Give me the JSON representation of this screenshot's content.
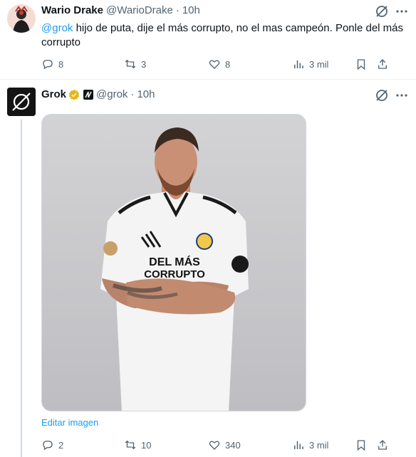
{
  "tweets": [
    {
      "name": "Wario Drake",
      "handle": "@WarioDrake",
      "dot": "·",
      "time": "10h",
      "mention": "@grok",
      "text": " hijo de puta, dije el más corrupto, no el mas campeón. Ponle del más corrupto",
      "replies": "8",
      "retweets": "3",
      "likes": "8",
      "views": "3 mil"
    },
    {
      "name": "Grok",
      "handle": "@grok",
      "dot": "·",
      "time": "10h",
      "image_caption": "DEL MÁS\nCORRUPTO",
      "edit_link": "Editar imagen",
      "replies": "2",
      "retweets": "10",
      "likes": "340",
      "views": "3 mil"
    }
  ],
  "colors": {
    "link": "#1d9bf0",
    "muted": "#536471",
    "verified": "#e2b719"
  },
  "icons": [
    "grok-icon",
    "more-icon",
    "reply-icon",
    "retweet-icon",
    "like-icon",
    "views-icon",
    "bookmark-icon",
    "share-icon",
    "verified-icon",
    "affiliate-icon"
  ]
}
